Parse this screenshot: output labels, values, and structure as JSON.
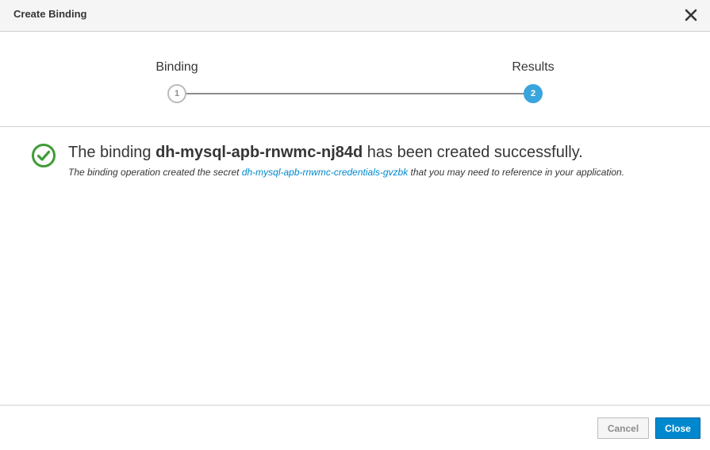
{
  "dialog": {
    "title": "Create Binding"
  },
  "wizard": {
    "steps": [
      {
        "label": "Binding",
        "number": "1",
        "state": "complete"
      },
      {
        "label": "Results",
        "number": "2",
        "state": "active"
      }
    ]
  },
  "result": {
    "prefix": "The binding ",
    "binding_name": "dh-mysql-apb-rnwmc-nj84d",
    "suffix": " has been created successfully.",
    "detail_prefix": "The binding operation created the secret ",
    "secret_name": "dh-mysql-apb-rnwmc-credentials-gvzbk",
    "detail_suffix": " that you may need to reference in your application."
  },
  "footer": {
    "cancel_label": "Cancel",
    "close_label": "Close"
  },
  "colors": {
    "accent": "#39a5dc",
    "primary_button": "#0088ce",
    "success": "#3f9c35",
    "link": "#0088ce"
  },
  "icons": {
    "close": "close-icon",
    "success": "check-circle-icon"
  }
}
